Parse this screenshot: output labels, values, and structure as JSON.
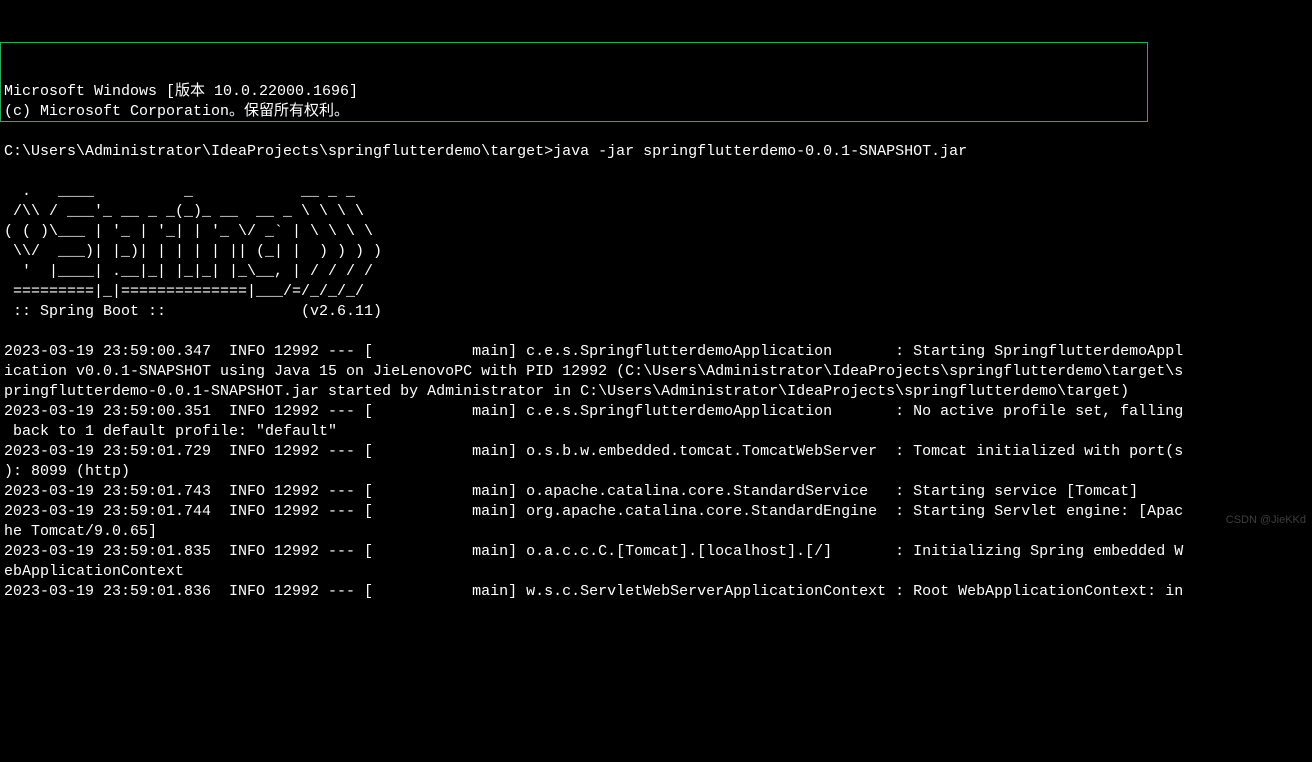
{
  "header": {
    "line1": "Microsoft Windows [版本 10.0.22000.1696]",
    "line2": "(c) Microsoft Corporation。保留所有权利。"
  },
  "prompt": {
    "cwd": "C:\\Users\\Administrator\\IdeaProjects\\springflutterdemo\\target>",
    "command": "java -jar springflutterdemo-0.0.1-SNAPSHOT.jar"
  },
  "banner": {
    "l1": "  .   ____          _            __ _ _",
    "l2": " /\\\\ / ___'_ __ _ _(_)_ __  __ _ \\ \\ \\ \\",
    "l3": "( ( )\\___ | '_ | '_| | '_ \\/ _` | \\ \\ \\ \\",
    "l4": " \\\\/  ___)| |_)| | | | | || (_| |  ) ) ) )",
    "l5": "  '  |____| .__|_| |_|_| |_\\__, | / / / /",
    "l6": " =========|_|==============|___/=/_/_/_/",
    "l7": " :: Spring Boot ::               (v2.6.11)"
  },
  "logs": {
    "l1": "2023-03-19 23:59:00.347  INFO 12992 --- [           main] c.e.s.SpringflutterdemoApplication       : Starting SpringflutterdemoAppl",
    "l2": "ication v0.0.1-SNAPSHOT using Java 15 on JieLenovoPC with PID 12992 (C:\\Users\\Administrator\\IdeaProjects\\springflutterdemo\\target\\s",
    "l3": "pringflutterdemo-0.0.1-SNAPSHOT.jar started by Administrator in C:\\Users\\Administrator\\IdeaProjects\\springflutterdemo\\target)",
    "l4": "2023-03-19 23:59:00.351  INFO 12992 --- [           main] c.e.s.SpringflutterdemoApplication       : No active profile set, falling",
    "l5": " back to 1 default profile: \"default\"",
    "l6": "2023-03-19 23:59:01.729  INFO 12992 --- [           main] o.s.b.w.embedded.tomcat.TomcatWebServer  : Tomcat initialized with port(s",
    "l7": "): 8099 (http)",
    "l8": "2023-03-19 23:59:01.743  INFO 12992 --- [           main] o.apache.catalina.core.StandardService   : Starting service [Tomcat]",
    "l9": "2023-03-19 23:59:01.744  INFO 12992 --- [           main] org.apache.catalina.core.StandardEngine  : Starting Servlet engine: [Apac",
    "l10": "he Tomcat/9.0.65]",
    "l11": "2023-03-19 23:59:01.835  INFO 12992 --- [           main] o.a.c.c.C.[Tomcat].[localhost].[/]       : Initializing Spring embedded W",
    "l12": "ebApplicationContext",
    "l13": "2023-03-19 23:59:01.836  INFO 12992 --- [           main] w.s.c.ServletWebServerApplicationContext : Root WebApplicationContext: in"
  },
  "watermark": "CSDN @JieKKd"
}
